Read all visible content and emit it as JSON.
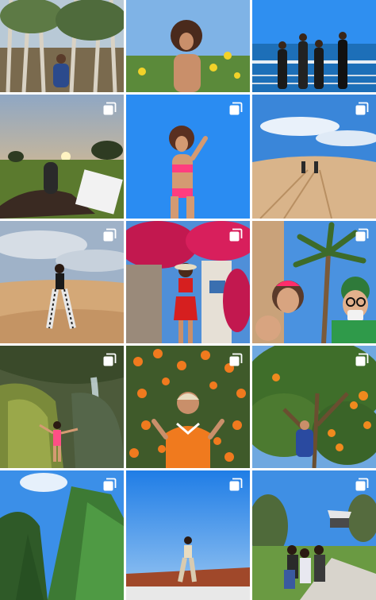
{
  "profile_grid": {
    "columns": 3,
    "multi_photo_icon": "multiple-photos-icon",
    "posts": [
      {
        "subject": "eucalyptus-grove-sitting",
        "multi_photo": false
      },
      {
        "subject": "wildflowers-portrait",
        "multi_photo": false
      },
      {
        "subject": "ocean-overlook-friends",
        "multi_photo": false
      },
      {
        "subject": "sunset-field-lying",
        "multi_photo": true
      },
      {
        "subject": "pink-swimsuit-blue-sky",
        "multi_photo": true
      },
      {
        "subject": "sand-dunes-walkers",
        "multi_photo": true
      },
      {
        "subject": "dune-pose-patterned-pants",
        "multi_photo": true
      },
      {
        "subject": "bougainvillea-red-outfit",
        "multi_photo": true
      },
      {
        "subject": "palm-tree-group-selfie",
        "multi_photo": true
      },
      {
        "subject": "waterfall-mossy-rock",
        "multi_photo": true
      },
      {
        "subject": "orange-flowers-jacket",
        "multi_photo": true
      },
      {
        "subject": "orange-tree-climbing",
        "multi_photo": true
      },
      {
        "subject": "pine-trees-blue-sky",
        "multi_photo": true
      },
      {
        "subject": "rooftop-sky-pose",
        "multi_photo": true
      },
      {
        "subject": "campus-library-group",
        "multi_photo": true
      }
    ]
  },
  "colors": {
    "sky_blue": "#2f8ff0",
    "sand": "#d9b48a",
    "foliage": "#2f6b2a",
    "accent_orange": "#f07a1e",
    "accent_pink": "#ff3d7f"
  }
}
